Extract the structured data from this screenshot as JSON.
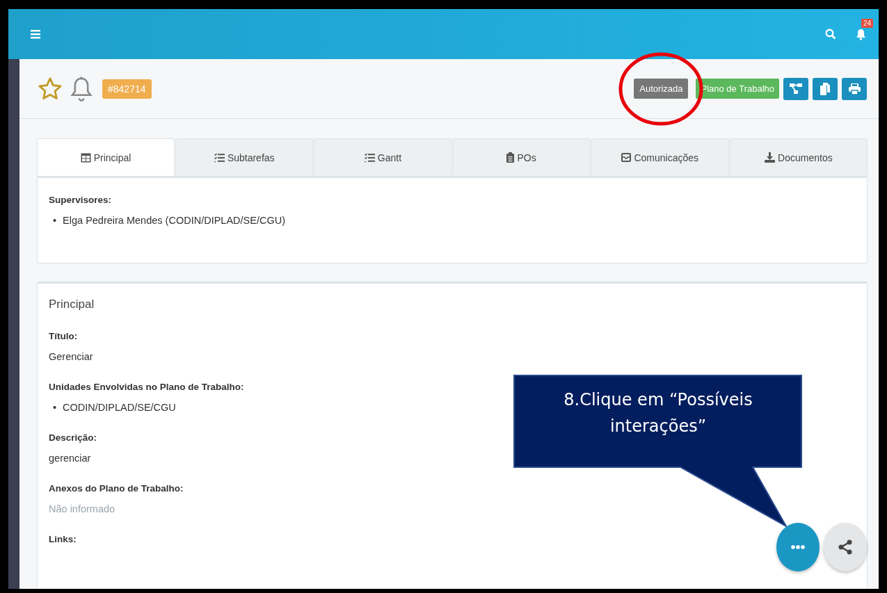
{
  "topbar": {
    "notification_count": "24"
  },
  "header": {
    "ticket": "#842714",
    "status": "Autorizada",
    "type": "Plano de Trabalho"
  },
  "tabs": [
    {
      "label": "Principal",
      "selected": true
    },
    {
      "label": "Subtarefas",
      "selected": false
    },
    {
      "label": "Gantt",
      "selected": false
    },
    {
      "label": "POs",
      "selected": false
    },
    {
      "label": "Comunicações",
      "selected": false
    },
    {
      "label": "Documentos",
      "selected": false
    }
  ],
  "supervisors": {
    "label": "Supervisores:",
    "items": [
      {
        "marker": "•",
        "text": "Elga Pedreira Mendes (CODIN/DIPLAD/SE/CGU)"
      }
    ]
  },
  "section": {
    "title": "Principal",
    "fields": [
      {
        "label": "Título:",
        "kind": "text",
        "value": "Gerenciar"
      },
      {
        "label": "Unidades Envolvidas no Plano de Trabalho:",
        "kind": "list",
        "items": [
          {
            "marker": "•",
            "text": "CODIN/DIPLAD/SE/CGU"
          }
        ]
      },
      {
        "label": "Descrição:",
        "kind": "text",
        "value": "gerenciar"
      },
      {
        "label": "Anexos do Plano de Trabalho:",
        "kind": "empty",
        "value": "Não informado"
      },
      {
        "label": "Links:",
        "kind": "label_only"
      }
    ]
  },
  "callout": {
    "text": "8.Clique em “Possíveis interações”"
  }
}
